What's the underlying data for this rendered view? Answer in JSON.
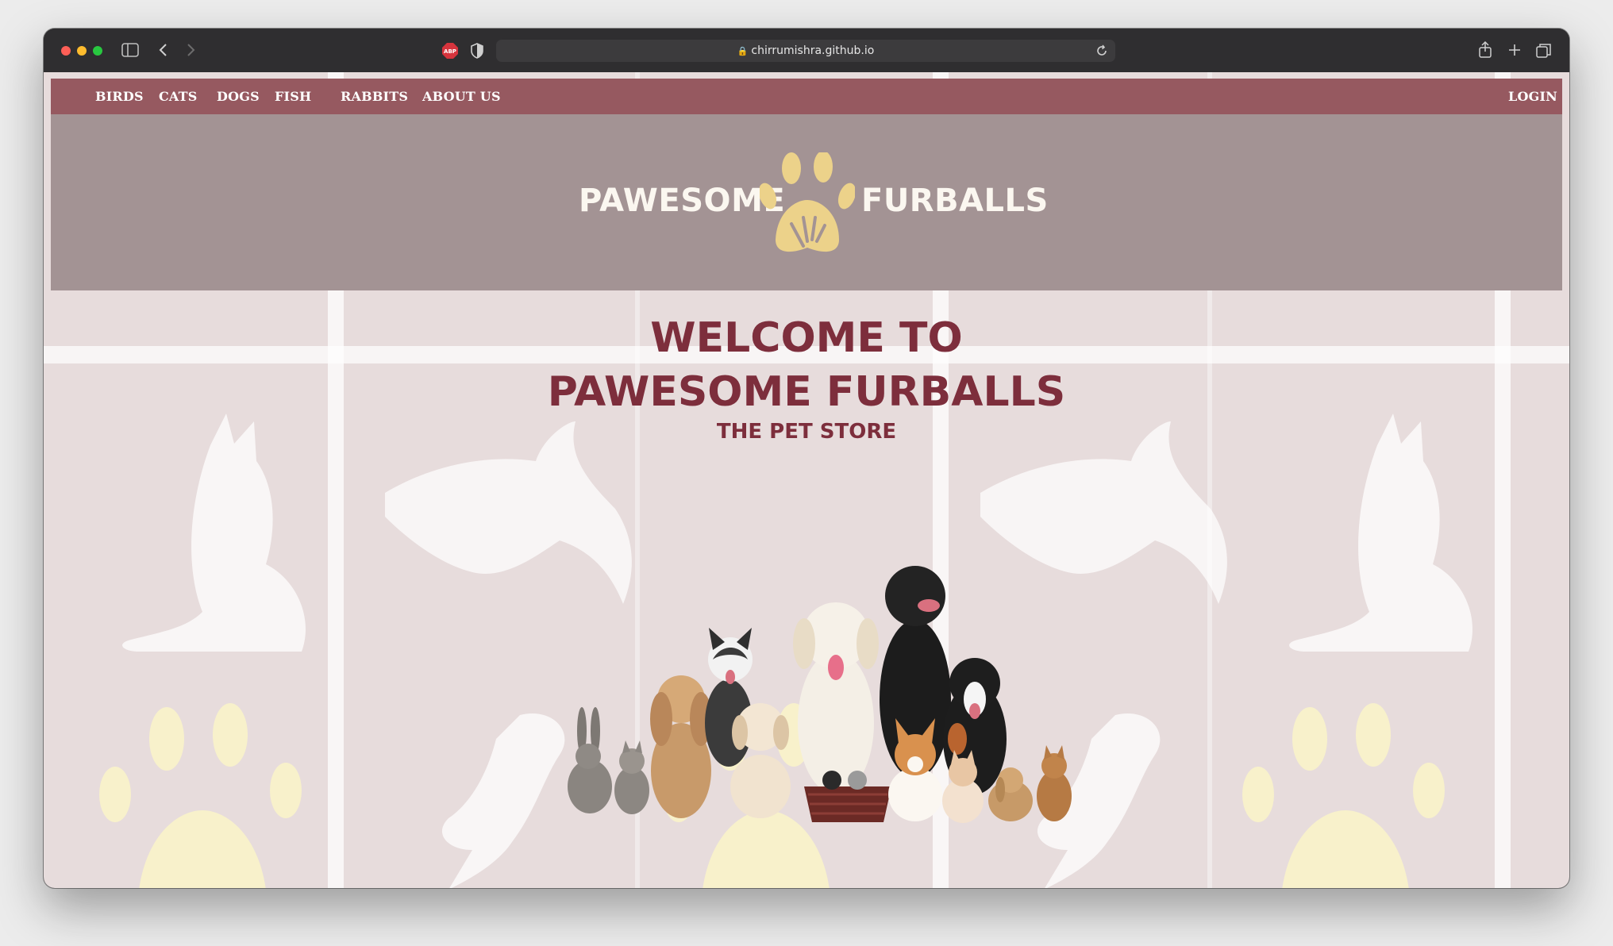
{
  "browser": {
    "url": "chirrumishra.github.io",
    "icons": [
      "sidebar-icon",
      "back-icon",
      "forward-icon",
      "adblock-icon",
      "shield-icon",
      "reload-icon",
      "share-icon",
      "new-tab-icon",
      "tabs-overview-icon"
    ]
  },
  "nav": {
    "items": [
      {
        "label": "BIRDS"
      },
      {
        "label": "CATS"
      },
      {
        "label": "DOGS"
      },
      {
        "label": "FISH"
      },
      {
        "label": "RABBITS"
      },
      {
        "label": "ABOUT US"
      }
    ],
    "login": "LOGIN"
  },
  "logo": {
    "left": "PAWESOME",
    "right": "FURBALLS"
  },
  "hero": {
    "line1": "WELCOME TO",
    "line2": "PAWESOME FURBALLS",
    "subtitle": "THE PET STORE"
  },
  "colors": {
    "nav": "#965960",
    "banner": "#a39394",
    "accent": "#7d2e3c",
    "paw": "#ecd28a"
  }
}
